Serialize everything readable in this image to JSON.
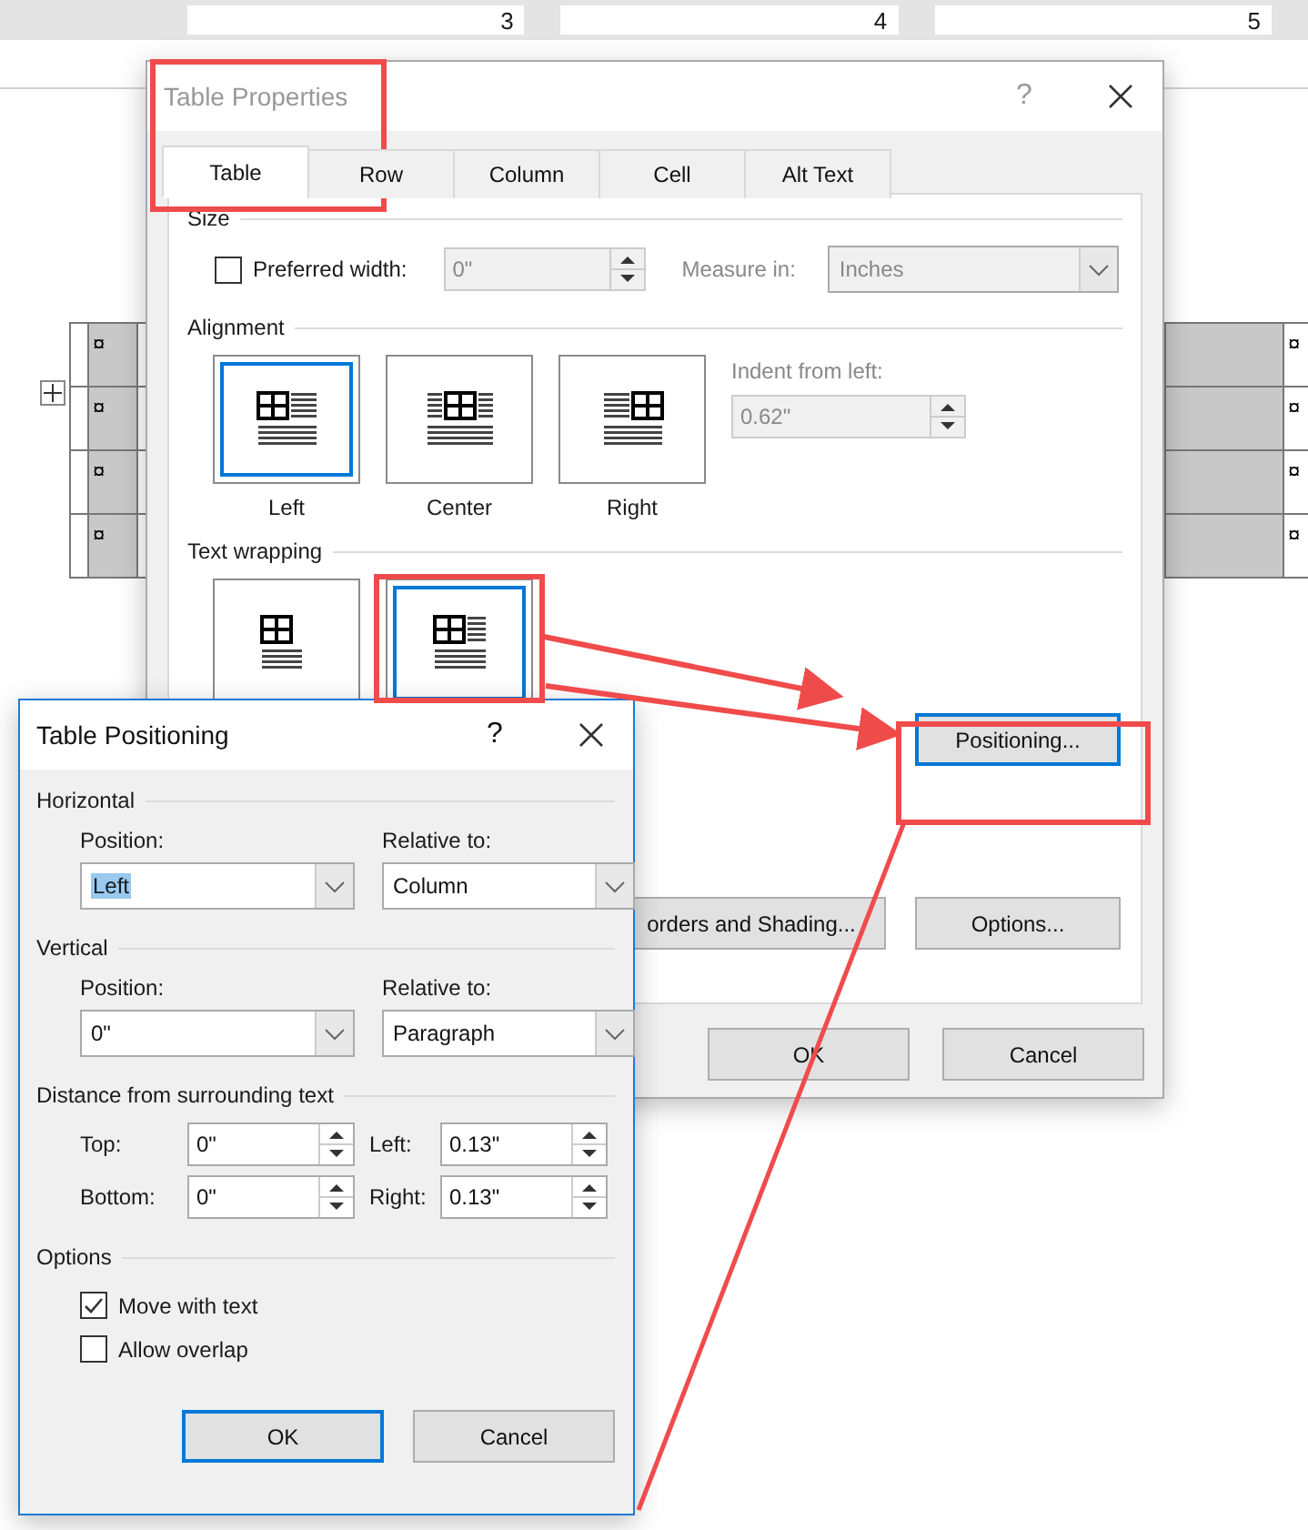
{
  "ruler": {
    "numbers": [
      "3",
      "4",
      "5"
    ]
  },
  "document_table": {
    "rows": [
      {
        "left": "¤",
        "right": "¤"
      },
      {
        "left": "¤",
        "right": "¤"
      },
      {
        "left": "¤",
        "right": "¤"
      },
      {
        "left": "¤",
        "right": "¤"
      }
    ]
  },
  "table_properties": {
    "title": "Table Properties",
    "help": "?",
    "tabs": [
      {
        "label": "Table",
        "selected": true
      },
      {
        "label": "Row",
        "selected": false
      },
      {
        "label": "Column",
        "selected": false
      },
      {
        "label": "Cell",
        "selected": false
      },
      {
        "label": "Alt Text",
        "selected": false
      }
    ],
    "size": {
      "heading": "Size",
      "preferred_width": {
        "label": "Preferred width:",
        "checked": false,
        "value": "0\""
      },
      "measure_in": {
        "label": "Measure in:",
        "value": "Inches"
      }
    },
    "alignment": {
      "heading": "Alignment",
      "options": [
        {
          "label": "Left",
          "selected": true
        },
        {
          "label": "Center",
          "selected": false
        },
        {
          "label": "Right",
          "selected": false
        }
      ],
      "indent": {
        "label": "Indent from left:",
        "value": "0.62\""
      }
    },
    "text_wrapping": {
      "heading": "Text wrapping",
      "options": [
        {
          "selected": false
        },
        {
          "selected": true
        }
      ]
    },
    "positioning_button": "Positioning...",
    "buttons": [
      "orders and Shading...",
      "Options..."
    ],
    "footer_buttons": [
      "OK",
      "Cancel"
    ]
  },
  "table_positioning": {
    "title": "Table Positioning",
    "help": "?",
    "horizontal": {
      "heading": "Horizontal",
      "position_label": "Position:",
      "position": "Left",
      "relative_label": "Relative to:",
      "relative": "Column"
    },
    "vertical": {
      "heading": "Vertical",
      "position_label": "Position:",
      "position": "0\"",
      "relative_label": "Relative to:",
      "relative": "Paragraph"
    },
    "distance": {
      "heading": "Distance from surrounding text",
      "fields": [
        {
          "label": "Top:",
          "value": "0\""
        },
        {
          "label": "Left:",
          "value": "0.13\""
        },
        {
          "label": "Bottom:",
          "value": "0\""
        },
        {
          "label": "Right:",
          "value": "0.13\""
        }
      ]
    },
    "options": {
      "heading": "Options",
      "items": [
        {
          "label": "Move with text",
          "checked": true
        },
        {
          "label": "Allow overlap",
          "checked": false
        }
      ]
    },
    "buttons": [
      "OK",
      "Cancel"
    ]
  }
}
